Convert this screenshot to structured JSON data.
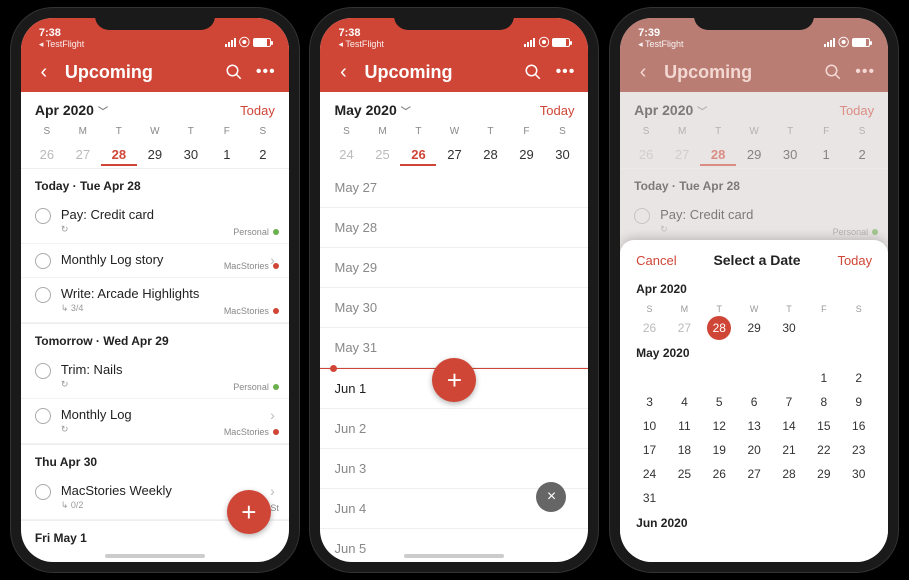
{
  "screens": [
    {
      "status": {
        "time": "7:38",
        "carrier": "TestFlight"
      },
      "nav": {
        "title": "Upcoming"
      },
      "month": {
        "label": "Apr 2020",
        "today": "Today"
      },
      "dow": [
        "S",
        "M",
        "T",
        "W",
        "T",
        "F",
        "S"
      ],
      "dates": [
        {
          "n": "26",
          "faded": true
        },
        {
          "n": "27",
          "faded": true
        },
        {
          "n": "28",
          "today": true
        },
        {
          "n": "29"
        },
        {
          "n": "30"
        },
        {
          "n": "1"
        },
        {
          "n": "2"
        }
      ],
      "sections": [
        {
          "hdr": "Today · Tue Apr 28",
          "tasks": [
            {
              "title": "Pay: Credit card",
              "sub": "↻",
              "tag": "Personal",
              "dot": "g"
            },
            {
              "title": "Monthly Log story",
              "tag": "MacStories",
              "dot": "r",
              "chev": true
            },
            {
              "title": "Write: Arcade Highlights",
              "sub": "↳ 3/4",
              "tag": "MacStories",
              "dot": "r"
            }
          ]
        },
        {
          "hdr": "Tomorrow · Wed Apr 29",
          "tasks": [
            {
              "title": "Trim: Nails",
              "sub": "↻",
              "tag": "Personal",
              "dot": "g"
            },
            {
              "title": "Monthly Log",
              "sub": "↻",
              "tag": "MacStories",
              "dot": "r",
              "chev": true
            }
          ]
        },
        {
          "hdr": "Thu Apr 30",
          "tasks": [
            {
              "title": "MacStories Weekly",
              "sub": "↳ 0/2",
              "tag": "MacSt",
              "chev": true
            }
          ]
        },
        {
          "hdr": "Fri May 1",
          "tasks": []
        }
      ]
    },
    {
      "status": {
        "time": "7:38",
        "carrier": "TestFlight"
      },
      "nav": {
        "title": "Upcoming"
      },
      "month": {
        "label": "May 2020",
        "today": "Today"
      },
      "dow": [
        "S",
        "M",
        "T",
        "W",
        "T",
        "F",
        "S"
      ],
      "dates": [
        {
          "n": "24",
          "faded": true
        },
        {
          "n": "25",
          "faded": true
        },
        {
          "n": "26",
          "today": true
        },
        {
          "n": "27"
        },
        {
          "n": "28"
        },
        {
          "n": "29"
        },
        {
          "n": "30"
        }
      ],
      "dateList": [
        "May 27",
        "May 28",
        "May 29",
        "May 30",
        "May 31",
        "Jun 1",
        "Jun 2",
        "Jun 3",
        "Jun 4",
        "Jun 5"
      ],
      "lineAfter": 4
    },
    {
      "status": {
        "time": "7:39",
        "carrier": "TestFlight"
      },
      "nav": {
        "title": "Upcoming",
        "dim": true
      },
      "month": {
        "label": "Apr 2020",
        "today": "Today"
      },
      "dow": [
        "S",
        "M",
        "T",
        "W",
        "T",
        "F",
        "S"
      ],
      "dates": [
        {
          "n": "26",
          "faded": true
        },
        {
          "n": "27",
          "faded": true
        },
        {
          "n": "28",
          "today": true
        },
        {
          "n": "29"
        },
        {
          "n": "30"
        },
        {
          "n": "1"
        },
        {
          "n": "2"
        }
      ],
      "sections": [
        {
          "hdr": "Today · Tue Apr 28",
          "tasks": [
            {
              "title": "Pay: Credit card",
              "sub": "↻",
              "tag": "Personal",
              "dot": "g"
            }
          ]
        }
      ],
      "sheet": {
        "cancel": "Cancel",
        "title": "Select a Date",
        "today": "Today",
        "months": [
          {
            "label": "Apr 2020",
            "dow": [
              "S",
              "M",
              "T",
              "W",
              "T",
              "F",
              "S"
            ],
            "rows": [
              [
                {
                  "n": "26",
                  "fd": true
                },
                {
                  "n": "27",
                  "fd": true
                },
                {
                  "n": "28",
                  "sel": true
                },
                {
                  "n": "29"
                },
                {
                  "n": "30"
                },
                {
                  "n": ""
                },
                {
                  "n": ""
                }
              ]
            ]
          },
          {
            "label": "May 2020",
            "rows": [
              [
                {
                  "n": ""
                },
                {
                  "n": ""
                },
                {
                  "n": ""
                },
                {
                  "n": ""
                },
                {
                  "n": ""
                },
                {
                  "n": "1"
                },
                {
                  "n": "2"
                }
              ],
              [
                {
                  "n": "3"
                },
                {
                  "n": "4"
                },
                {
                  "n": "5"
                },
                {
                  "n": "6"
                },
                {
                  "n": "7"
                },
                {
                  "n": "8"
                },
                {
                  "n": "9"
                }
              ],
              [
                {
                  "n": "10"
                },
                {
                  "n": "11"
                },
                {
                  "n": "12"
                },
                {
                  "n": "13"
                },
                {
                  "n": "14"
                },
                {
                  "n": "15"
                },
                {
                  "n": "16"
                }
              ],
              [
                {
                  "n": "17"
                },
                {
                  "n": "18"
                },
                {
                  "n": "19"
                },
                {
                  "n": "20"
                },
                {
                  "n": "21"
                },
                {
                  "n": "22"
                },
                {
                  "n": "23"
                }
              ],
              [
                {
                  "n": "24"
                },
                {
                  "n": "25"
                },
                {
                  "n": "26"
                },
                {
                  "n": "27"
                },
                {
                  "n": "28"
                },
                {
                  "n": "29"
                },
                {
                  "n": "30"
                }
              ],
              [
                {
                  "n": "31"
                },
                {
                  "n": ""
                },
                {
                  "n": ""
                },
                {
                  "n": ""
                },
                {
                  "n": ""
                },
                {
                  "n": ""
                },
                {
                  "n": ""
                }
              ]
            ]
          },
          {
            "label": "Jun 2020",
            "rows": []
          }
        ]
      }
    }
  ]
}
